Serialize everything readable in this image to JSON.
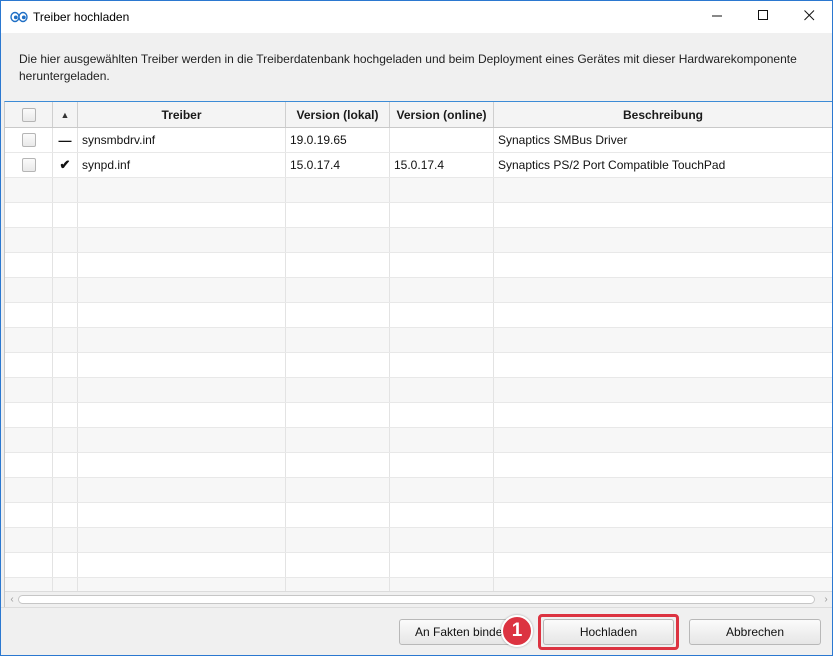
{
  "window": {
    "title": "Treiber hochladen",
    "icon": "eyes-icon",
    "controls": {
      "minimize": "minimize-icon",
      "maximize": "maximize-icon",
      "close": "close-icon"
    }
  },
  "description": "Die hier ausgewählten Treiber werden in die Treiberdatenbank hochgeladen und beim Deployment eines Gerätes mit dieser Hardwarekomponente heruntergeladen.",
  "table": {
    "columns": {
      "select": "",
      "sort": "▲",
      "driver": "Treiber",
      "version_local": "Version (lokal)",
      "version_online": "Version (online)",
      "description": "Beschreibung"
    },
    "rows": [
      {
        "status": "—",
        "driver": "synsmbdrv.inf",
        "version_local": "19.0.19.65",
        "version_online": "",
        "description": "Synaptics SMBus Driver"
      },
      {
        "status": "✔",
        "driver": "synpd.inf",
        "version_local": "15.0.17.4",
        "version_online": "15.0.17.4",
        "description": "Synaptics PS/2 Port Compatible TouchPad"
      }
    ],
    "scroll_left": "‹",
    "scroll_right": "›"
  },
  "buttons": {
    "bind_facts": "An Fakten binden",
    "upload": "Hochladen",
    "cancel": "Abbrechen"
  },
  "annotation": {
    "marker": "1",
    "color": "#dc3341"
  },
  "colors": {
    "accent": "#2b78d0",
    "header_line": "#3c8bd6"
  }
}
